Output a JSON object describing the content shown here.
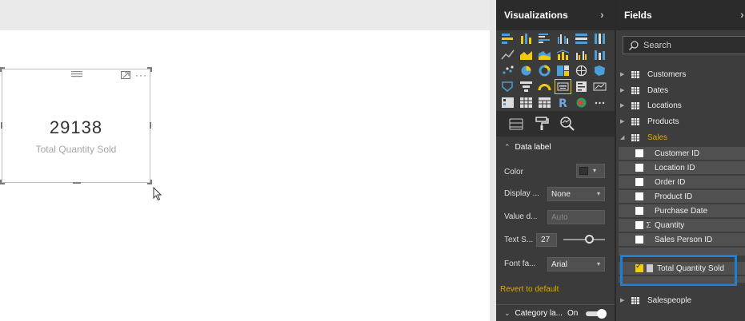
{
  "card": {
    "value": "29138",
    "label": "Total Quantity Sold"
  },
  "visualizations": {
    "title": "Visualizations",
    "sections": {
      "data_label": "Data label",
      "category_label": "Category la...",
      "category_label_state": "On"
    },
    "properties": {
      "color_label": "Color",
      "display_label": "Display ...",
      "display_value": "None",
      "value_decimals_label": "Value d...",
      "value_decimals_value": "Auto",
      "text_size_label": "Text S...",
      "text_size_value": "27",
      "font_family_label": "Font fa...",
      "font_family_value": "Arial"
    },
    "revert_label": "Revert to default",
    "palette": {
      "accent": "#f2c811",
      "bg": "#3b3b3b"
    }
  },
  "fields": {
    "title": "Fields",
    "search_placeholder": "Search",
    "tables": [
      {
        "name": "Customers"
      },
      {
        "name": "Dates"
      },
      {
        "name": "Locations"
      },
      {
        "name": "Products"
      },
      {
        "name": "Sales"
      },
      {
        "name": "Salespeople"
      }
    ],
    "sales_fields": [
      {
        "name": "Customer ID"
      },
      {
        "name": "Location ID"
      },
      {
        "name": "Order ID"
      },
      {
        "name": "Product ID"
      },
      {
        "name": "Purchase Date"
      },
      {
        "name": "Quantity",
        "icon": "Σ"
      },
      {
        "name": "Sales Person ID"
      },
      {
        "name": "Total Quantity Sold"
      }
    ],
    "highlight_color": "#1e7fd8"
  }
}
